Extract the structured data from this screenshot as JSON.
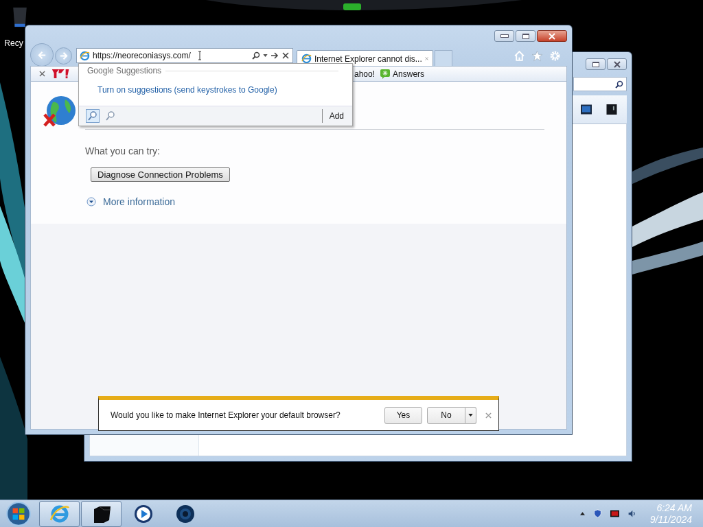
{
  "desktop": {
    "icons": [
      {
        "label": "Recy"
      }
    ]
  },
  "browser": {
    "address": "https://neoreconiasys.com/",
    "tabs": [
      {
        "label": "Internet Explorer cannot dis...",
        "selected": true
      }
    ],
    "favorites": [
      {
        "label": "ahoo!",
        "kind": "yahoo"
      },
      {
        "label": "Answers",
        "kind": "answers"
      }
    ],
    "suggestions": {
      "title": "Google Suggestions",
      "link": "Turn on suggestions (send keystrokes to Google)",
      "add": "Add"
    },
    "page": {
      "try_label": "What you can try:",
      "diagnose_button": "Diagnose Connection Problems",
      "more_info": "More information"
    },
    "notification": {
      "message": "Would you like to make Internet Explorer your default browser?",
      "yes": "Yes",
      "no": "No"
    }
  },
  "taskbar": {
    "apps": [
      {
        "kind": "ie",
        "running": true
      },
      {
        "kind": "terminal",
        "running": true
      },
      {
        "kind": "media",
        "running": false
      },
      {
        "kind": "globe",
        "running": false
      }
    ],
    "time": "6:24 AM",
    "date": "9/11/2024"
  }
}
